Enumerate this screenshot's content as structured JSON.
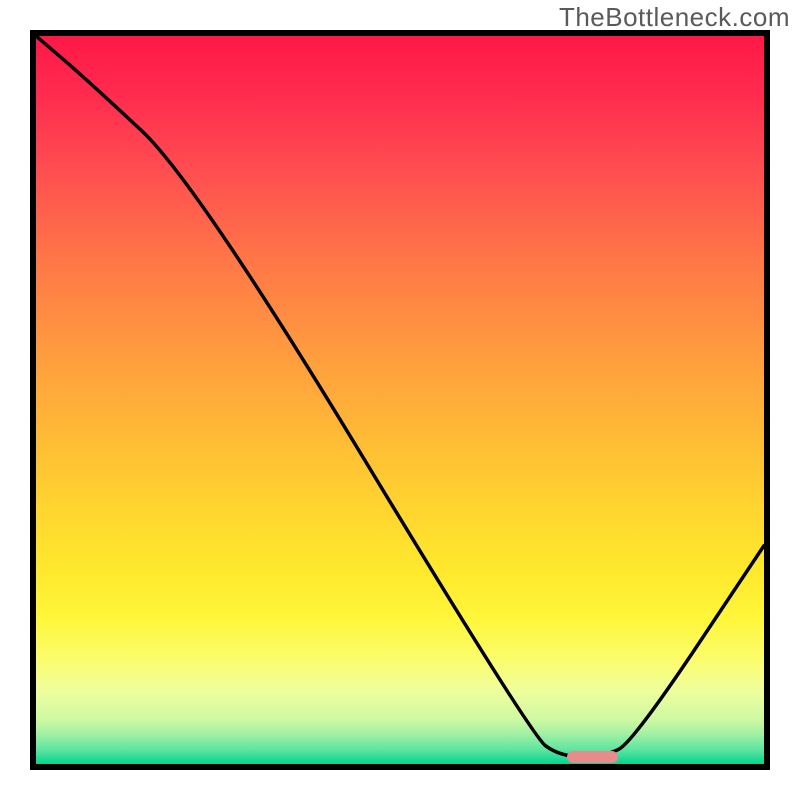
{
  "watermark": "TheBottleneck.com",
  "chart_data": {
    "type": "line",
    "title": "",
    "xlabel": "",
    "ylabel": "",
    "xlim": [
      0,
      100
    ],
    "ylim": [
      0,
      100
    ],
    "grid": false,
    "legend": false,
    "background_gradient": {
      "top_color": "#ff1846",
      "mid_color": "#ffd52f",
      "bottom_color": "#04d48f",
      "meaning": "red (high bottleneck) to green (optimal)"
    },
    "series": [
      {
        "name": "bottleneck-curve",
        "color": "#000000",
        "x": [
          0,
          7,
          22,
          68,
          72,
          78,
          82,
          100
        ],
        "values": [
          100,
          94,
          80,
          4,
          1,
          1,
          3,
          30
        ]
      }
    ],
    "optimal_marker": {
      "name": "optimal-range",
      "color": "#e88b8d",
      "x_start": 73,
      "x_end": 80,
      "y": 1
    },
    "annotations": []
  }
}
